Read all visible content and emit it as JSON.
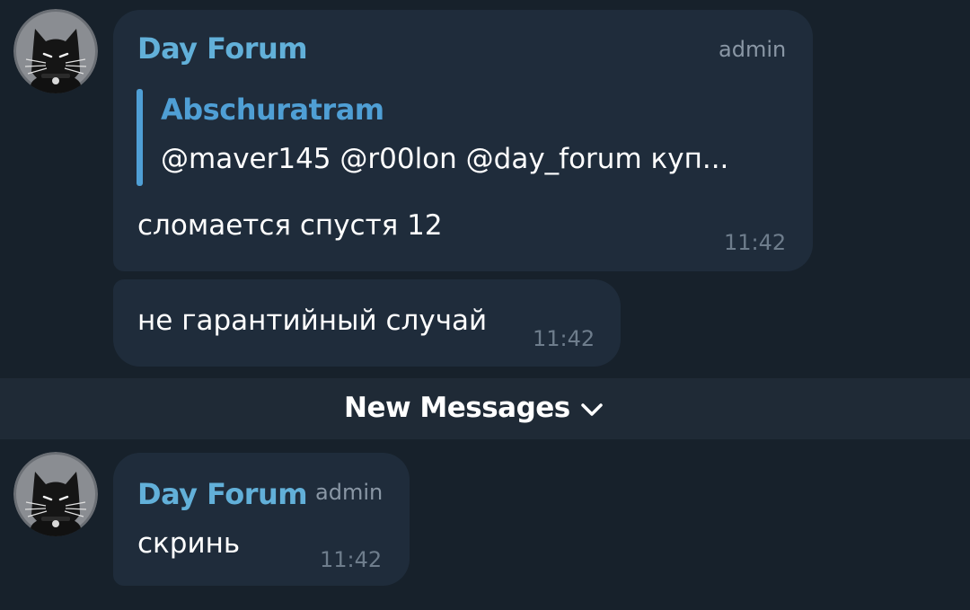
{
  "messages": [
    {
      "sender": "Day Forum",
      "role": "admin",
      "reply": {
        "author": "Abschuratram",
        "text": "@maver145 @r00lon @day_forum куп..."
      },
      "text": "сломается спустя 12",
      "time": "11:42"
    },
    {
      "text": "не гарантийный случай",
      "time": "11:42"
    }
  ],
  "divider": {
    "label": "New Messages",
    "icon": "chevron-down-icon"
  },
  "new_messages": [
    {
      "sender": "Day Forum",
      "role": "admin",
      "text": "скринь",
      "time": "11:42"
    }
  ],
  "avatar": {
    "icon": "black-cat-avatar-icon"
  },
  "colors": {
    "background": "#17212b",
    "bubble": "#1f2c3b",
    "divider_bar": "#1f2a36",
    "sender_name": "#62b0d9",
    "reply_accent": "#4f9fd5",
    "text": "#ffffff",
    "meta": "#6e7d8c"
  }
}
